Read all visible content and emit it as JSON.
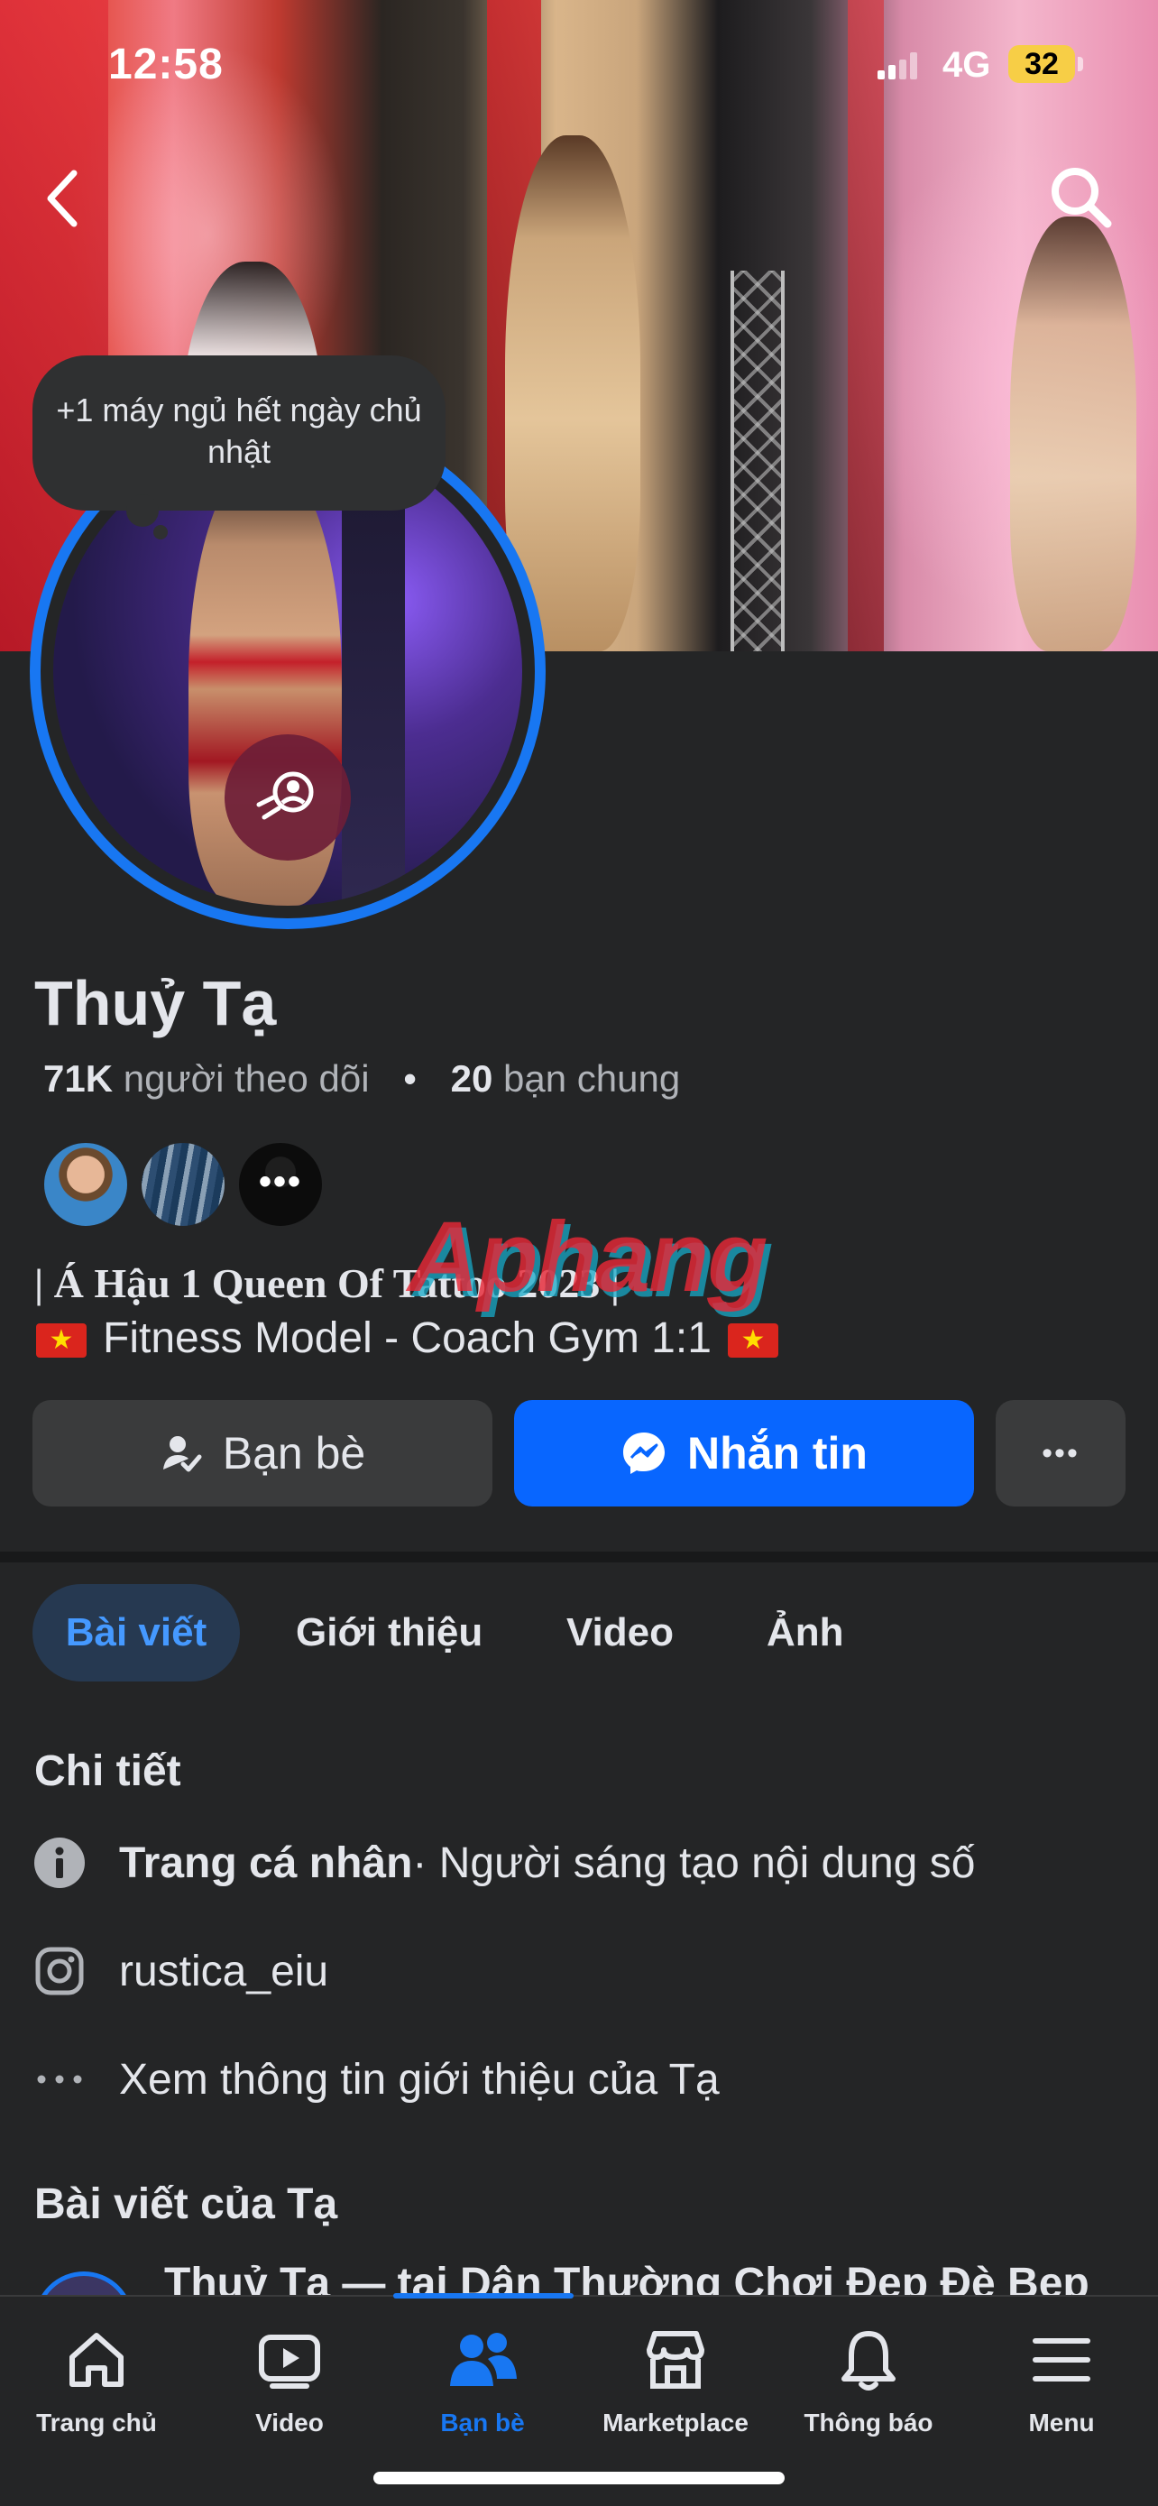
{
  "status_bar": {
    "time": "12:58",
    "network": "4G",
    "battery": "32"
  },
  "profile": {
    "note": "+1 máy ngủ hết ngày chủ nhật",
    "name": "Thuỷ Tạ",
    "followers_count": "71K",
    "followers_label": "người theo dõi",
    "separator": "•",
    "mutual_count": "20",
    "mutual_label": "bạn chung",
    "mutual_more": "•••",
    "bio_line1": "| Á Hậu 1 Queen Of Tattoo 2023 |",
    "bio_line2": "Fitness Model - Coach Gym 1:1",
    "watermark": "Aphang"
  },
  "actions": {
    "friends_label": "Bạn bè",
    "message_label": "Nhắn tin",
    "more_label": "•••"
  },
  "tabs": [
    {
      "label": "Bài viết"
    },
    {
      "label": "Giới thiệu"
    },
    {
      "label": "Video"
    },
    {
      "label": "Ảnh"
    }
  ],
  "details": {
    "title": "Chi tiết",
    "category_label": "Trang cá nhân",
    "category_value": " · Người sáng tạo nội dung số",
    "instagram": "rustica_eiu",
    "see_about": "Xem thông tin giới thiệu của Tạ"
  },
  "posts": {
    "title": "Bài viết của Tạ",
    "peek_text": "Thuỷ Tạ — tại Dân Thường Chơi Đẹp Đè Bẹp"
  },
  "bottom_nav": [
    {
      "label": "Trang chủ",
      "icon": "home-icon"
    },
    {
      "label": "Video",
      "icon": "video-icon"
    },
    {
      "label": "Bạn bè",
      "icon": "friends-icon",
      "active": true
    },
    {
      "label": "Marketplace",
      "icon": "marketplace-icon"
    },
    {
      "label": "Thông báo",
      "icon": "bell-icon"
    },
    {
      "label": "Menu",
      "icon": "menu-icon"
    }
  ],
  "colors": {
    "background": "#242526",
    "accent": "#0866ff",
    "active_tab_bg": "#263951",
    "active_tab_text": "#4599ff",
    "battery": "#f7ce46"
  }
}
